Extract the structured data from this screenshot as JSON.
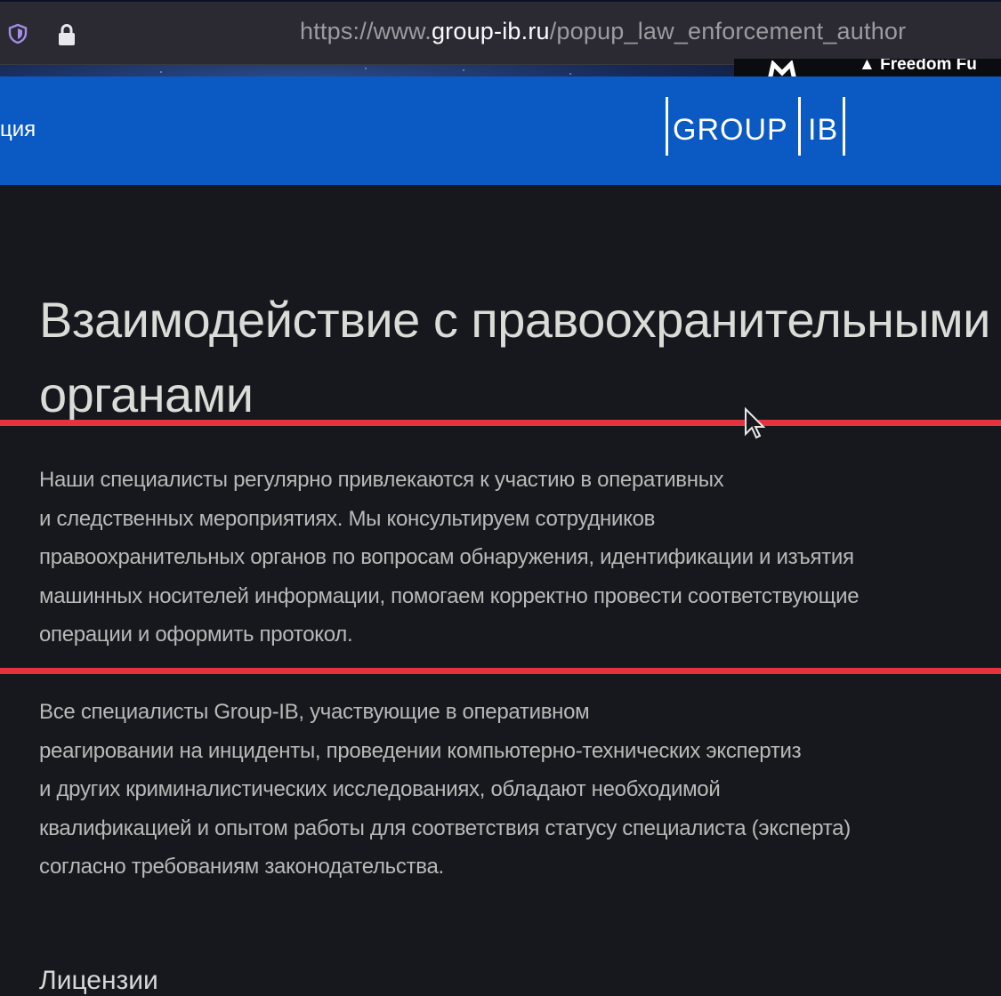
{
  "browser": {
    "url_prefix": "https://www.",
    "url_domain": "group-ib.ru",
    "url_path": "/popup_law_enforcement_author",
    "extension_label": "Freedom Fu",
    "icons": [
      "shield-icon",
      "lock-icon"
    ]
  },
  "header": {
    "nav_fragment": "ция",
    "logo_left": "GROUP",
    "logo_right": "IB",
    "background": "#0b5ac3"
  },
  "main": {
    "title_line1": "Взаимодействие с правоохранительными",
    "title_line2": "органами",
    "para1": [
      "Наши специалисты регулярно привлекаются к участию в оперативных",
      "и следственных мероприятиях. Мы консультируем сотрудников",
      "правоохранительных органов по вопросам обнаружения, идентификации и изъятия",
      "машинных носителей информации, помогаем корректно провести соответствующие",
      "операции и оформить протокол."
    ],
    "para2": [
      "Все специалисты Group-IB, участвующие в оперативном",
      "реагировании на инциденты, проведении компьютерно-технических экспертиз",
      "и других криминалистических исследованиях, обладают необходимой",
      "квалификацией и опытом работы для соответствия статусу специалиста (эксперта)",
      "согласно требованиям законодательства."
    ],
    "section_heading": "Лицензии",
    "highlight_color": "#e5333d"
  }
}
